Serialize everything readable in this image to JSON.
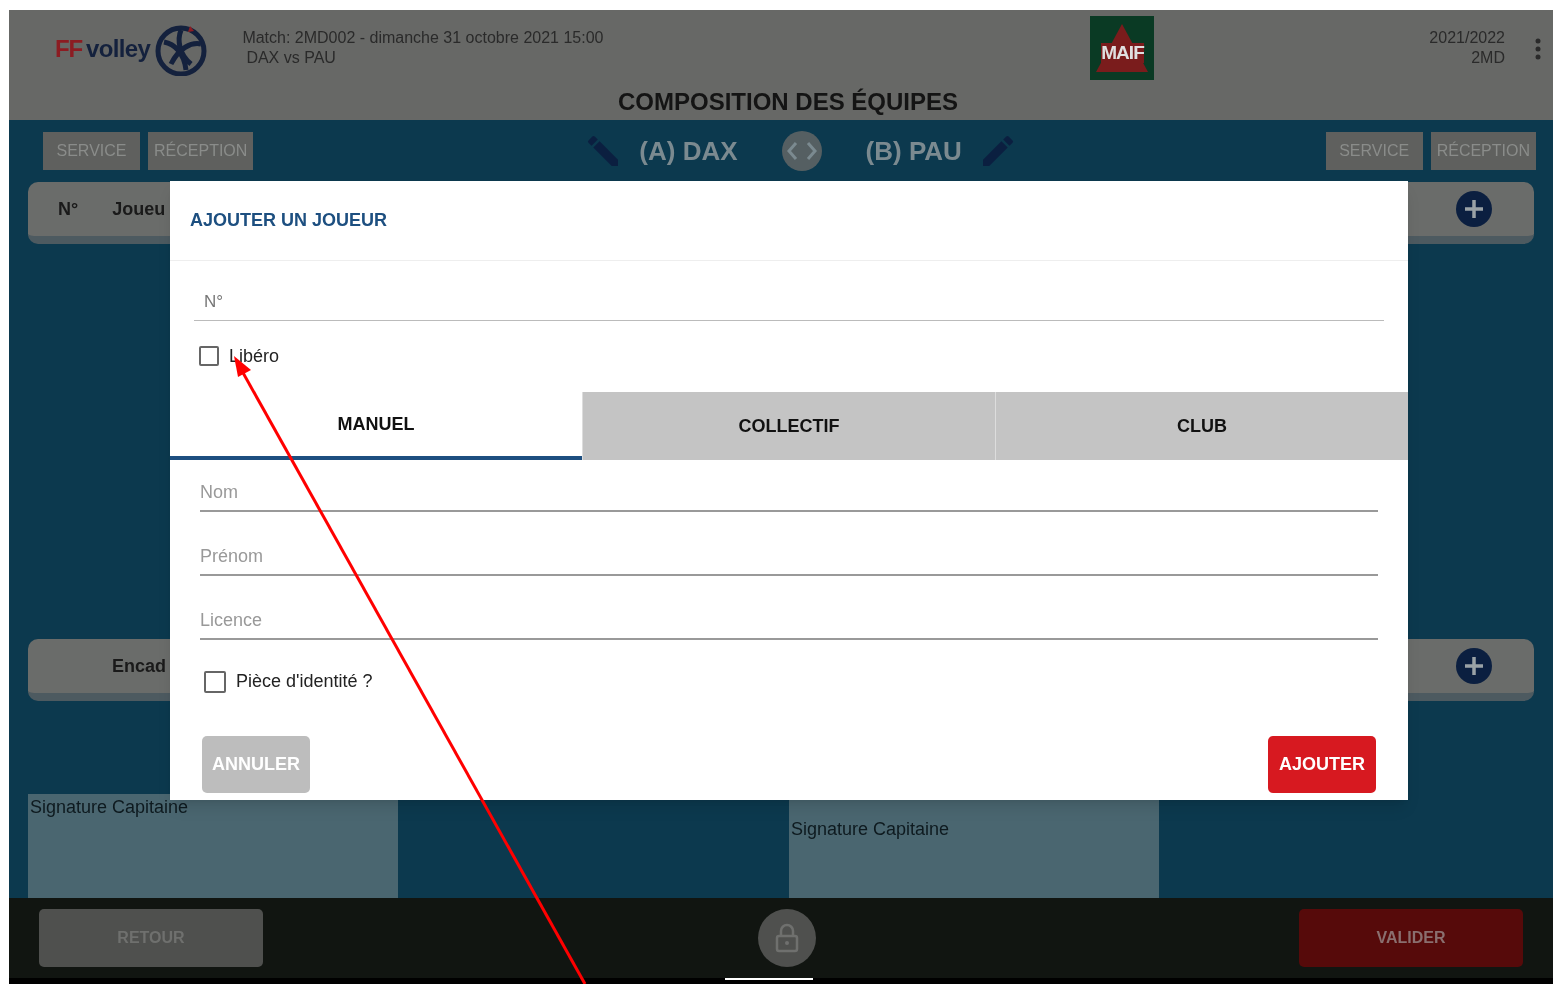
{
  "header": {
    "logo_prefix": "FF",
    "logo_name": "volley",
    "match_line": "Match: 2MD002 - dimanche 31 octobre 2021 15:00",
    "teams_line": "DAX vs PAU",
    "sponsor": "MAIF",
    "season": "2021/2022",
    "division": "2MD",
    "title": "COMPOSITION DES ÉQUIPES"
  },
  "toolbar": {
    "left_buttons": [
      "SERVICE",
      "RÉCEPTION"
    ],
    "team_a": "(A) DAX",
    "team_b": "(B) PAU",
    "right_buttons": [
      "SERVICE",
      "RÉCEPTION"
    ]
  },
  "left_panel": {
    "columns": [
      "N°",
      "Joueu"
    ],
    "staff": "Encad",
    "signature": "Signature Capitaine"
  },
  "right_panel": {
    "signature": "Signature Capitaine"
  },
  "modal": {
    "title": "AJOUTER UN JOUEUR",
    "number_field": {
      "placeholder": "N°"
    },
    "libero": {
      "label": "Libéro",
      "checked": false
    },
    "tabs": [
      {
        "label": "MANUEL",
        "selected": true
      },
      {
        "label": "COLLECTIF",
        "selected": false
      },
      {
        "label": "CLUB",
        "selected": false
      }
    ],
    "fields": [
      {
        "placeholder": "Nom"
      },
      {
        "placeholder": "Prénom"
      },
      {
        "placeholder": "Licence"
      }
    ],
    "id_check": {
      "label": "Pièce d'identité ?",
      "checked": false
    },
    "cancel": {
      "label": "ANNULER",
      "disabled": true
    },
    "submit": {
      "label": "AJOUTER"
    }
  },
  "footer": {
    "back": "RETOUR",
    "validate": "VALIDER"
  }
}
